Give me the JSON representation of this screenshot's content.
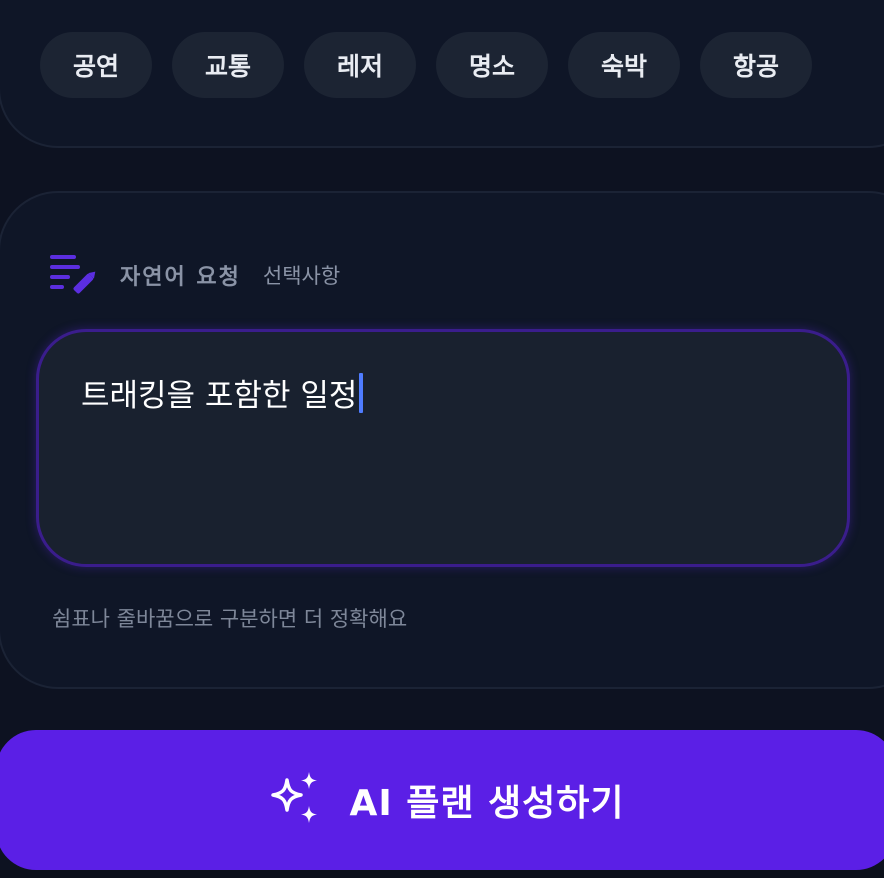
{
  "categories": {
    "items": [
      {
        "label": "공연"
      },
      {
        "label": "교통"
      },
      {
        "label": "레저"
      },
      {
        "label": "명소"
      },
      {
        "label": "숙박"
      },
      {
        "label": "항공"
      }
    ]
  },
  "request": {
    "title": "자연어 요청",
    "optional": "선택사항",
    "icon": "edit-notes-icon",
    "input_value": "트래킹을 포함한 일정",
    "helper": "쉼표나 줄바꿈으로 구분하면 더 정확해요"
  },
  "generate": {
    "label": "AI 플랜 생성하기",
    "icon": "sparkles-icon"
  },
  "colors": {
    "background": "#0d1221",
    "card": "#0f1627",
    "chip": "#1c2433",
    "accent": "#5b1fe6",
    "caret": "#4f7cff"
  }
}
